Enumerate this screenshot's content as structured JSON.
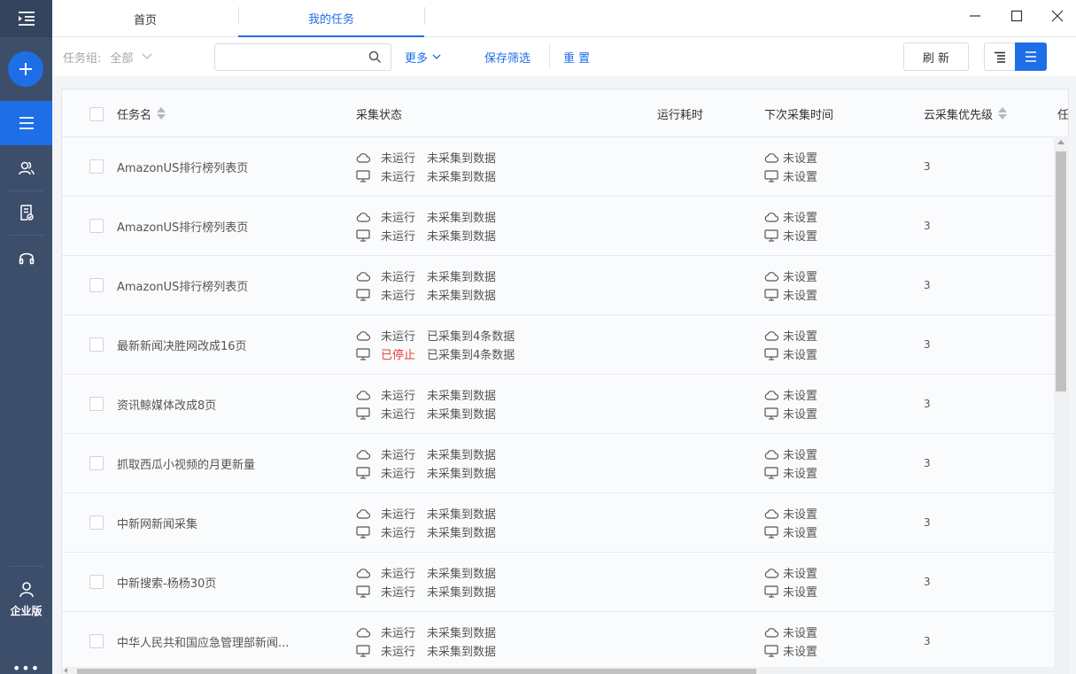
{
  "tabs": [
    {
      "label": "首页",
      "active": false
    },
    {
      "label": "我的任务",
      "active": true
    }
  ],
  "sidebar": {
    "enterprise_label": "企业版",
    "more_label": "•••"
  },
  "toolbar": {
    "group_label": "任务组:",
    "group_value": "全部",
    "search_placeholder": "",
    "more_label": "更多",
    "save_filter_label": "保存筛选",
    "reset_label": "重 置",
    "refresh_label": "刷 新"
  },
  "table": {
    "columns": [
      "任务名",
      "采集状态",
      "运行耗时",
      "下次采集时间",
      "云采集优先级",
      "任"
    ],
    "rows": [
      {
        "name": "AmazonUS排行榜列表页",
        "cloud_status": "未运行",
        "cloud_data": "未采集到数据",
        "local_status": "未运行",
        "local_data": "未采集到数据",
        "next_cloud": "未设置",
        "next_local": "未设置",
        "priority": "3"
      },
      {
        "name": "AmazonUS排行榜列表页",
        "cloud_status": "未运行",
        "cloud_data": "未采集到数据",
        "local_status": "未运行",
        "local_data": "未采集到数据",
        "next_cloud": "未设置",
        "next_local": "未设置",
        "priority": "3"
      },
      {
        "name": "AmazonUS排行榜列表页",
        "cloud_status": "未运行",
        "cloud_data": "未采集到数据",
        "local_status": "未运行",
        "local_data": "未采集到数据",
        "next_cloud": "未设置",
        "next_local": "未设置",
        "priority": "3"
      },
      {
        "name": "最新新闻决胜网改成16页",
        "cloud_status": "未运行",
        "cloud_data": "已采集到4条数据",
        "local_status": "已停止",
        "local_data": "已采集到4条数据",
        "next_cloud": "未设置",
        "next_local": "未设置",
        "priority": "3"
      },
      {
        "name": "资讯鲸媒体改成8页",
        "cloud_status": "未运行",
        "cloud_data": "未采集到数据",
        "local_status": "未运行",
        "local_data": "未采集到数据",
        "next_cloud": "未设置",
        "next_local": "未设置",
        "priority": "3"
      },
      {
        "name": "抓取西瓜小视频的月更新量",
        "cloud_status": "未运行",
        "cloud_data": "未采集到数据",
        "local_status": "未运行",
        "local_data": "未采集到数据",
        "next_cloud": "未设置",
        "next_local": "未设置",
        "priority": "3"
      },
      {
        "name": "中新网新闻采集",
        "cloud_status": "未运行",
        "cloud_data": "未采集到数据",
        "local_status": "未运行",
        "local_data": "未采集到数据",
        "next_cloud": "未设置",
        "next_local": "未设置",
        "priority": "3"
      },
      {
        "name": "中新搜索-杨杨30页",
        "cloud_status": "未运行",
        "cloud_data": "未采集到数据",
        "local_status": "未运行",
        "local_data": "未采集到数据",
        "next_cloud": "未设置",
        "next_local": "未设置",
        "priority": "3"
      },
      {
        "name": "中华人民共和国应急管理部新闻...",
        "cloud_status": "未运行",
        "cloud_data": "未采集到数据",
        "local_status": "未运行",
        "local_data": "未采集到数据",
        "next_cloud": "未设置",
        "next_local": "未设置",
        "priority": "3"
      }
    ]
  },
  "colors": {
    "accent": "#1e6ee8",
    "sidebar": "#3d4e6b",
    "stopped": "#e8413b"
  }
}
